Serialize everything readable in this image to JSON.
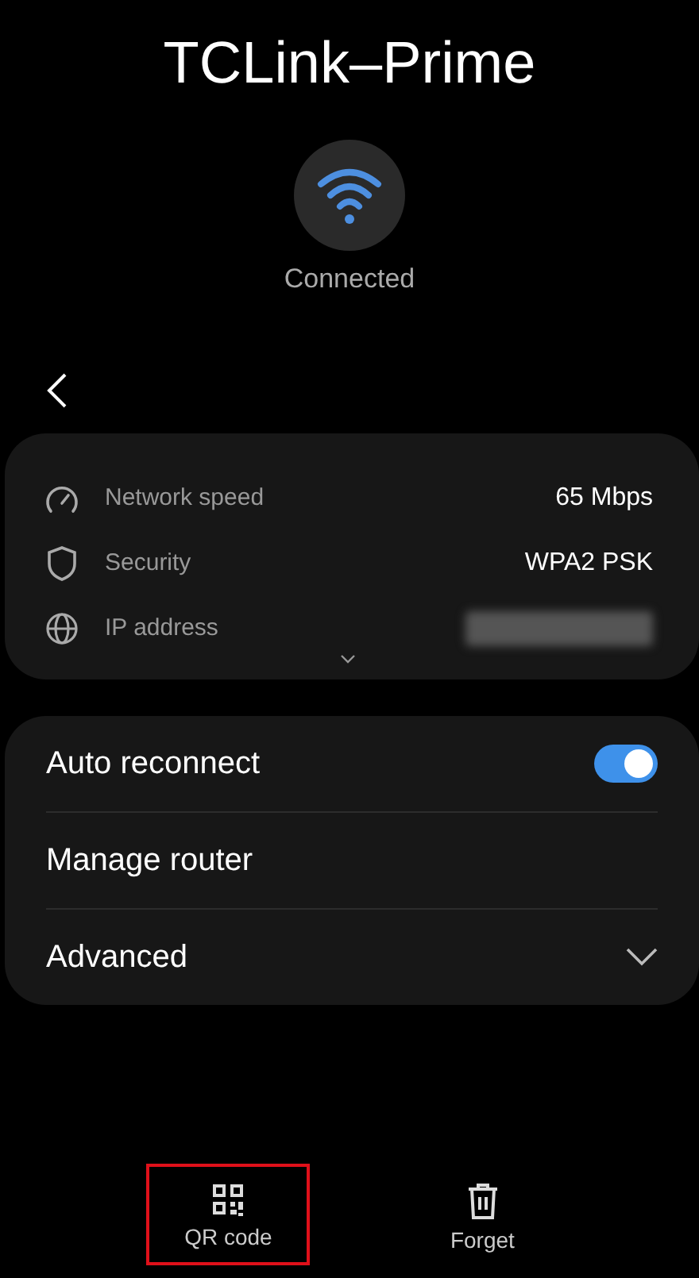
{
  "network": {
    "name": "TCLink–Prime",
    "status": "Connected"
  },
  "details": [
    {
      "kind": "speed",
      "label": "Network speed",
      "value": "65 Mbps"
    },
    {
      "kind": "security",
      "label": "Security",
      "value": "WPA2 PSK"
    },
    {
      "kind": "ip",
      "label": "IP address",
      "redacted": true
    }
  ],
  "settings": [
    {
      "kind": "toggle",
      "label": "Auto reconnect",
      "on": true
    },
    {
      "kind": "link",
      "label": "Manage router"
    },
    {
      "kind": "expand",
      "label": "Advanced",
      "expanded": false
    }
  ],
  "actions": [
    {
      "kind": "qr",
      "label": "QR code",
      "highlighted": true
    },
    {
      "kind": "trash",
      "label": "Forget",
      "highlighted": false
    }
  ]
}
